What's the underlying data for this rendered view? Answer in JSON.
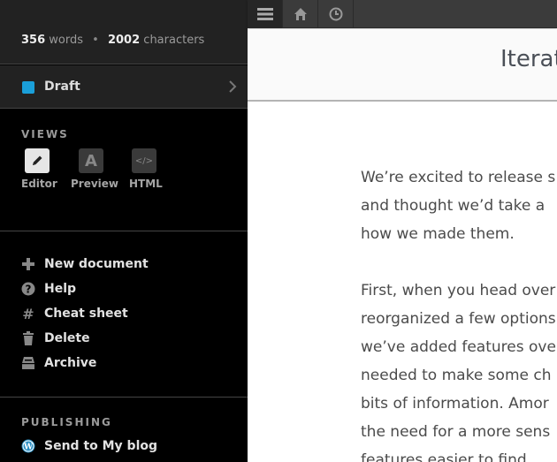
{
  "stats": {
    "words_count": "356",
    "words_label": "words",
    "separator": "•",
    "chars_count": "2002",
    "chars_label": "characters"
  },
  "status": {
    "label": "Draft",
    "color": "#1a9fd9"
  },
  "views": {
    "title": "VIEWS",
    "items": [
      {
        "label": "Editor",
        "icon": "pencil-icon",
        "active": true
      },
      {
        "label": "Preview",
        "icon": "preview-icon",
        "glyph": "A"
      },
      {
        "label": "HTML",
        "icon": "code-icon",
        "glyph": "</>"
      }
    ]
  },
  "menu": {
    "items": [
      {
        "label": "New document",
        "icon": "plus-icon"
      },
      {
        "label": "Help",
        "icon": "help-icon"
      },
      {
        "label": "Cheat sheet",
        "icon": "hash-icon",
        "glyph": "#"
      },
      {
        "label": "Delete",
        "icon": "trash-icon"
      },
      {
        "label": "Archive",
        "icon": "archive-icon"
      }
    ]
  },
  "publishing": {
    "title": "PUBLISHING",
    "items": [
      {
        "label": "Send to My blog",
        "icon": "wordpress-icon"
      }
    ]
  },
  "toolbar": {
    "buttons": [
      "menu-icon",
      "home-icon",
      "history-icon"
    ]
  },
  "document": {
    "title": "Iterat",
    "paragraphs": [
      [
        "We’re excited to release s",
        "and thought we’d take a",
        "how we made them."
      ],
      [
        "First, when you head over",
        "reorganized a few options",
        "we’ve added features ove",
        "needed to make some ch",
        "bits of information. Amor",
        "the need for a more sens",
        "features easier to find."
      ]
    ]
  }
}
